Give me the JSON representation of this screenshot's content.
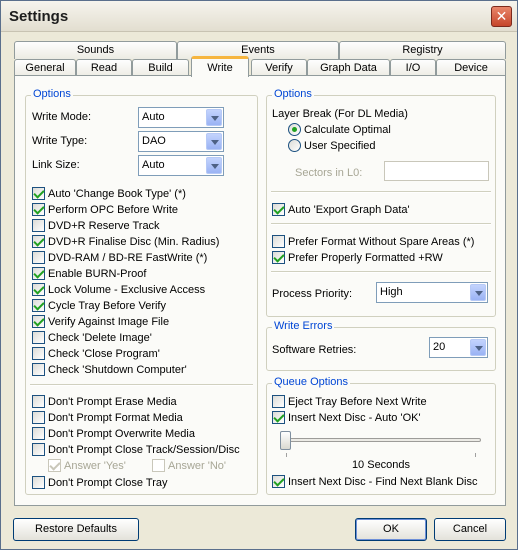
{
  "window": {
    "title": "Settings"
  },
  "tabs_back": [
    "Sounds",
    "Events",
    "Registry"
  ],
  "tabs_front": [
    "General",
    "Read",
    "Build",
    "Write",
    "Verify",
    "Graph Data",
    "I/O",
    "Device"
  ],
  "active_tab": "Write",
  "left_options": {
    "title": "Options",
    "write_mode_label": "Write Mode:",
    "write_mode_value": "Auto",
    "write_type_label": "Write Type:",
    "write_type_value": "DAO",
    "link_size_label": "Link Size:",
    "link_size_value": "Auto",
    "checkboxes": [
      {
        "label": "Auto 'Change Book Type' (*)",
        "checked": true
      },
      {
        "label": "Perform OPC Before Write",
        "checked": true
      },
      {
        "label": "DVD+R Reserve Track",
        "checked": false
      },
      {
        "label": "DVD+R Finalise Disc (Min. Radius)",
        "checked": true
      },
      {
        "label": "DVD-RAM / BD-RE FastWrite (*)",
        "checked": false
      },
      {
        "label": "Enable BURN-Proof",
        "checked": true
      },
      {
        "label": "Lock Volume - Exclusive Access",
        "checked": true
      },
      {
        "label": "Cycle Tray Before Verify",
        "checked": true
      },
      {
        "label": "Verify Against Image File",
        "checked": true
      },
      {
        "label": "Check 'Delete Image'",
        "checked": false
      },
      {
        "label": "Check 'Close Program'",
        "checked": false
      },
      {
        "label": "Check 'Shutdown Computer'",
        "checked": false
      }
    ],
    "prompts": [
      {
        "label": "Don't Prompt Erase Media",
        "checked": false
      },
      {
        "label": "Don't Prompt Format Media",
        "checked": false
      },
      {
        "label": "Don't Prompt Overwrite Media",
        "checked": false
      },
      {
        "label": "Don't Prompt Close Track/Session/Disc",
        "checked": false
      }
    ],
    "answer_yes": {
      "label": "Answer 'Yes'",
      "checked": true
    },
    "answer_no": {
      "label": "Answer 'No'",
      "checked": false
    },
    "close_tray": {
      "label": "Don't Prompt Close Tray",
      "checked": false
    }
  },
  "right_options": {
    "title": "Options",
    "layer_break_label": "Layer Break (For DL Media)",
    "radio_calc": "Calculate Optimal",
    "radio_user": "User Specified",
    "sectors_label": "Sectors in L0:",
    "export_graph": "Auto 'Export Graph Data'",
    "prefer_format": "Prefer Format Without Spare Areas (*)",
    "prefer_properly": "Prefer Properly Formatted +RW",
    "priority_label": "Process Priority:",
    "priority_value": "High"
  },
  "write_errors": {
    "title": "Write Errors",
    "retries_label": "Software Retries:",
    "retries_value": "20"
  },
  "queue_options": {
    "title": "Queue Options",
    "eject_tray": "Eject Tray Before Next Write",
    "insert_auto_ok": "Insert Next Disc - Auto 'OK'",
    "slider_value_text": "10 Seconds",
    "slider_level": 0.0,
    "insert_find_blank": "Insert Next Disc - Find Next Blank Disc"
  },
  "buttons": {
    "restore": "Restore Defaults",
    "ok": "OK",
    "cancel": "Cancel"
  }
}
